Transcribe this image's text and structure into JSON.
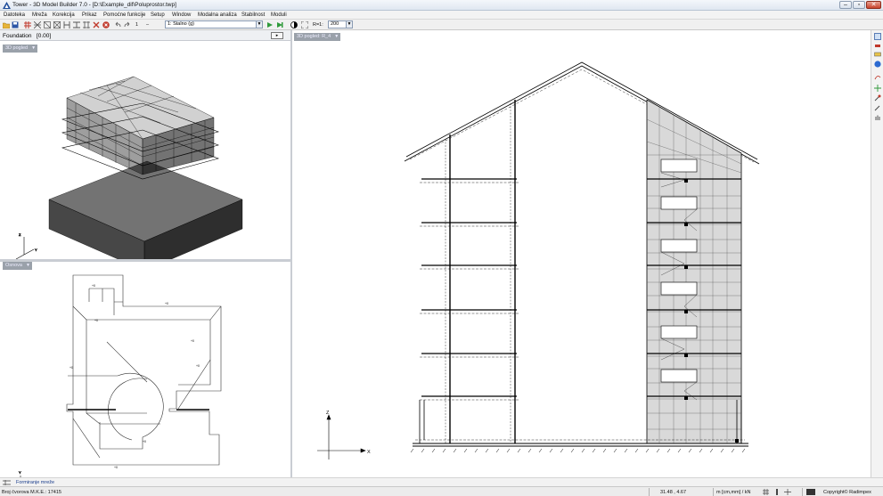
{
  "window": {
    "title": "Tower - 3D Model Builder 7.0 - [D:\\Example_dif\\Poluprostor.twp]",
    "controls": [
      "–",
      "▫",
      "✕"
    ]
  },
  "menu": [
    "Datoteka",
    "Mreža",
    "Korekcija",
    "Prikaz",
    "Pomoćne funkcije",
    "Setup",
    "Window",
    "Modalna analiza",
    "Stabilnost",
    "Moduli"
  ],
  "toolbar": {
    "case_number": "1",
    "load_case": "1: Stalno (g)",
    "ratio_label": "R=1:",
    "ratio_value": "200"
  },
  "left_panel": {
    "title": "Foundation",
    "level": "[0.00]",
    "nav_icon": "▸",
    "view_top": "3D pogled",
    "view_bottom": "Osnova"
  },
  "right_panel": {
    "view": "3D pogled: R_4",
    "axis_x": "X",
    "axis_z": "Z"
  },
  "footer": {
    "tab": "Formiranje mreže"
  },
  "status": {
    "nodes": "Broj čvorova M.K.E.: 17415",
    "coords": "31.48 , 4.67",
    "units": "m [cm,mm] / kN",
    "copyright": "Copyright© Radimpex"
  },
  "colors": {
    "accent": "#1f4e9c",
    "view_tag": "#9aa1aa",
    "wall_fill": "#d9d9d9"
  }
}
